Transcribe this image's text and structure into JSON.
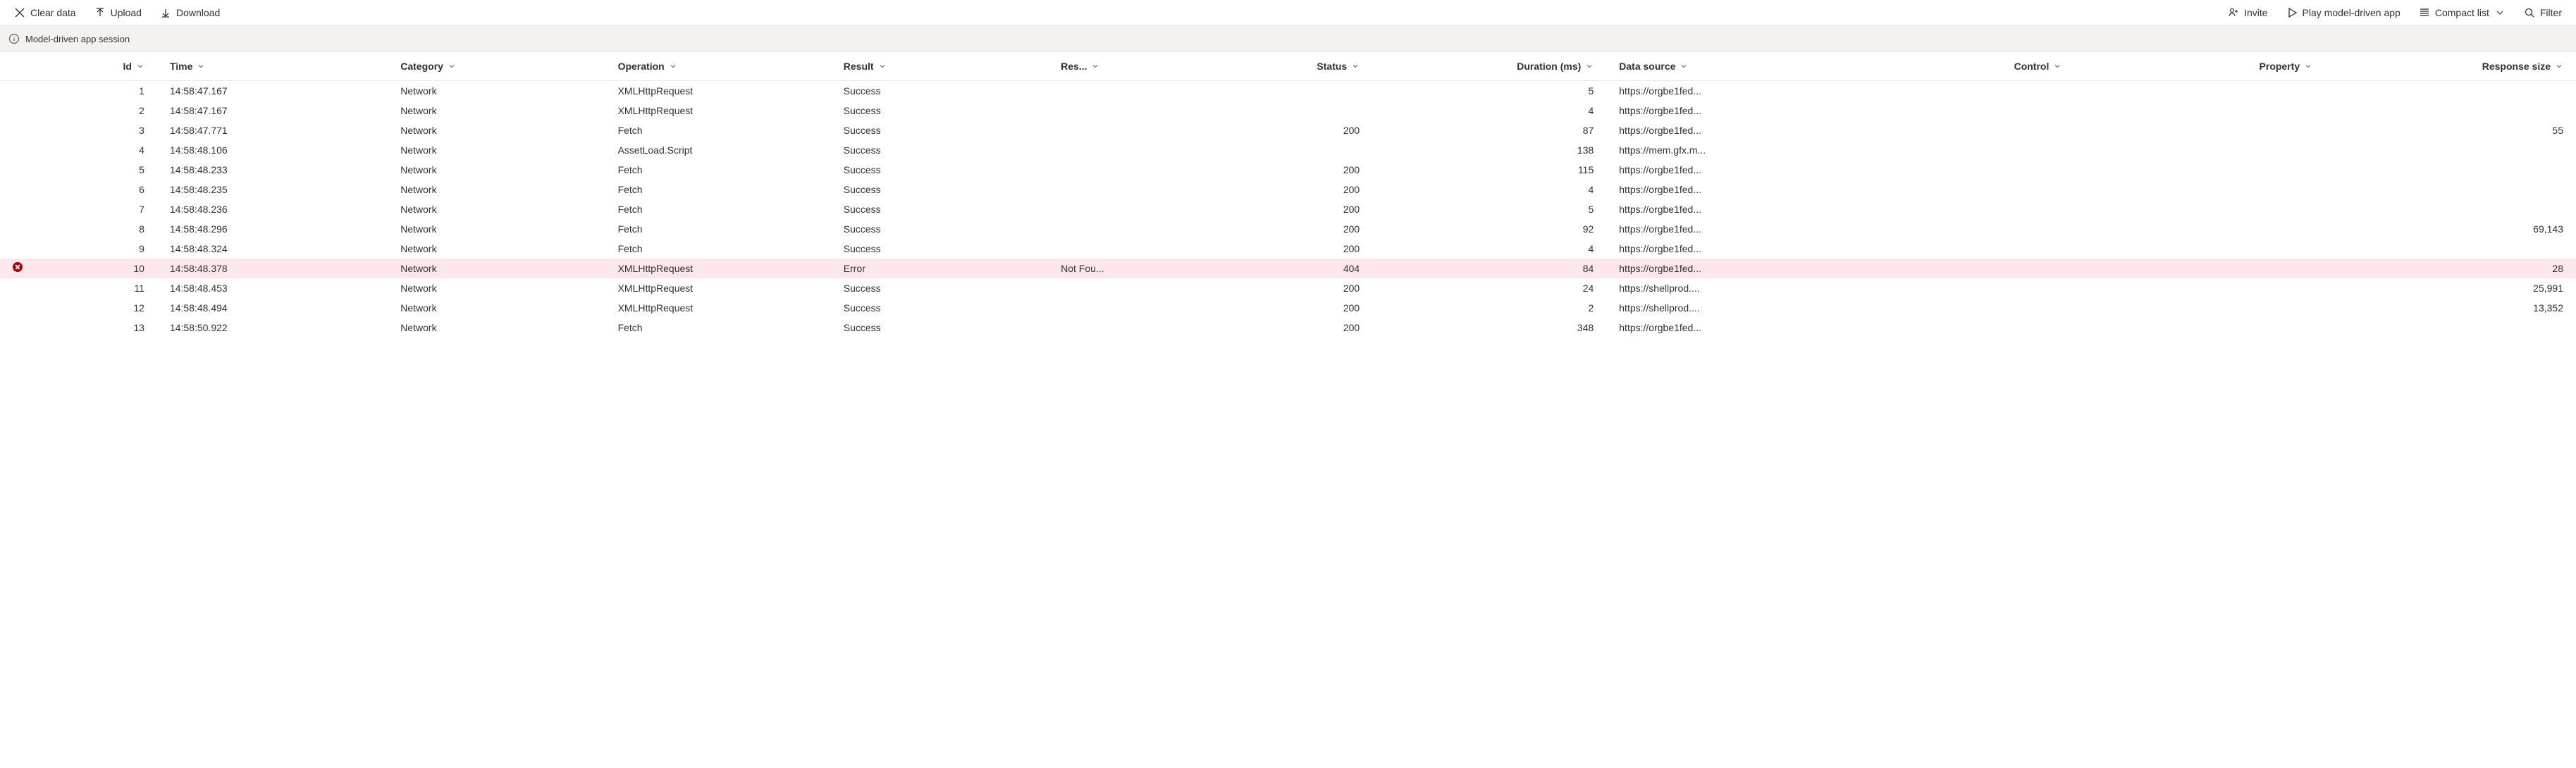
{
  "toolbar": {
    "clear_data": "Clear data",
    "upload": "Upload",
    "download": "Download",
    "invite": "Invite",
    "play": "Play model-driven app",
    "compact": "Compact list",
    "filter": "Filter"
  },
  "session_bar": {
    "label": "Model-driven app session"
  },
  "columns": {
    "id": "Id",
    "time": "Time",
    "category": "Category",
    "operation": "Operation",
    "result": "Result",
    "res": "Res...",
    "status": "Status",
    "duration": "Duration (ms)",
    "datasource": "Data source",
    "control": "Control",
    "property": "Property",
    "responsesize": "Response size"
  },
  "rows": [
    {
      "error": false,
      "id": "1",
      "time": "14:58:47.167",
      "category": "Network",
      "operation": "XMLHttpRequest",
      "result": "Success",
      "res": "",
      "status": "",
      "duration": "5",
      "datasource": "https://orgbe1fed...",
      "control": "",
      "property": "",
      "responsesize": ""
    },
    {
      "error": false,
      "id": "2",
      "time": "14:58:47.167",
      "category": "Network",
      "operation": "XMLHttpRequest",
      "result": "Success",
      "res": "",
      "status": "",
      "duration": "4",
      "datasource": "https://orgbe1fed...",
      "control": "",
      "property": "",
      "responsesize": ""
    },
    {
      "error": false,
      "id": "3",
      "time": "14:58:47.771",
      "category": "Network",
      "operation": "Fetch",
      "result": "Success",
      "res": "",
      "status": "200",
      "duration": "87",
      "datasource": "https://orgbe1fed...",
      "control": "",
      "property": "",
      "responsesize": "55"
    },
    {
      "error": false,
      "id": "4",
      "time": "14:58:48.106",
      "category": "Network",
      "operation": "AssetLoad.Script",
      "result": "Success",
      "res": "",
      "status": "",
      "duration": "138",
      "datasource": "https://mem.gfx.m...",
      "control": "",
      "property": "",
      "responsesize": ""
    },
    {
      "error": false,
      "id": "5",
      "time": "14:58:48.233",
      "category": "Network",
      "operation": "Fetch",
      "result": "Success",
      "res": "",
      "status": "200",
      "duration": "115",
      "datasource": "https://orgbe1fed...",
      "control": "",
      "property": "",
      "responsesize": ""
    },
    {
      "error": false,
      "id": "6",
      "time": "14:58:48.235",
      "category": "Network",
      "operation": "Fetch",
      "result": "Success",
      "res": "",
      "status": "200",
      "duration": "4",
      "datasource": "https://orgbe1fed...",
      "control": "",
      "property": "",
      "responsesize": ""
    },
    {
      "error": false,
      "id": "7",
      "time": "14:58:48.236",
      "category": "Network",
      "operation": "Fetch",
      "result": "Success",
      "res": "",
      "status": "200",
      "duration": "5",
      "datasource": "https://orgbe1fed...",
      "control": "",
      "property": "",
      "responsesize": ""
    },
    {
      "error": false,
      "id": "8",
      "time": "14:58:48.296",
      "category": "Network",
      "operation": "Fetch",
      "result": "Success",
      "res": "",
      "status": "200",
      "duration": "92",
      "datasource": "https://orgbe1fed...",
      "control": "",
      "property": "",
      "responsesize": "69,143"
    },
    {
      "error": false,
      "id": "9",
      "time": "14:58:48.324",
      "category": "Network",
      "operation": "Fetch",
      "result": "Success",
      "res": "",
      "status": "200",
      "duration": "4",
      "datasource": "https://orgbe1fed...",
      "control": "",
      "property": "",
      "responsesize": ""
    },
    {
      "error": true,
      "id": "10",
      "time": "14:58:48.378",
      "category": "Network",
      "operation": "XMLHttpRequest",
      "result": "Error",
      "res": "Not Fou...",
      "status": "404",
      "duration": "84",
      "datasource": "https://orgbe1fed...",
      "control": "",
      "property": "",
      "responsesize": "28"
    },
    {
      "error": false,
      "id": "11",
      "time": "14:58:48.453",
      "category": "Network",
      "operation": "XMLHttpRequest",
      "result": "Success",
      "res": "",
      "status": "200",
      "duration": "24",
      "datasource": "https://shellprod....",
      "control": "",
      "property": "",
      "responsesize": "25,991"
    },
    {
      "error": false,
      "id": "12",
      "time": "14:58:48.494",
      "category": "Network",
      "operation": "XMLHttpRequest",
      "result": "Success",
      "res": "",
      "status": "200",
      "duration": "2",
      "datasource": "https://shellprod....",
      "control": "",
      "property": "",
      "responsesize": "13,352"
    },
    {
      "error": false,
      "id": "13",
      "time": "14:58:50.922",
      "category": "Network",
      "operation": "Fetch",
      "result": "Success",
      "res": "",
      "status": "200",
      "duration": "348",
      "datasource": "https://orgbe1fed...",
      "control": "",
      "property": "",
      "responsesize": ""
    }
  ]
}
